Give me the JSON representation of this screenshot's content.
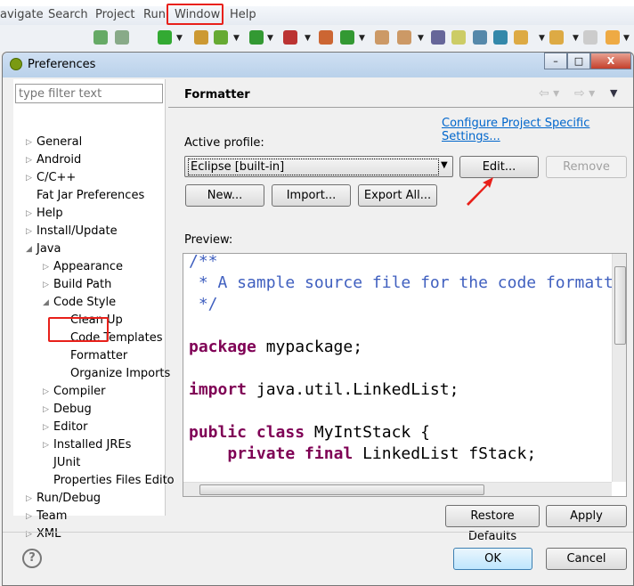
{
  "menubar": {
    "items": [
      "avigate",
      "Search",
      "Project",
      "Run",
      "Window",
      "Help"
    ]
  },
  "dialog": {
    "title": "Preferences",
    "window_buttons": [
      "minimize",
      "maximize",
      "close"
    ],
    "filter_placeholder": "type filter text",
    "tree": [
      {
        "label": "General",
        "level": 0,
        "arrow": "collapsed"
      },
      {
        "label": "Android",
        "level": 0,
        "arrow": "collapsed"
      },
      {
        "label": "C/C++",
        "level": 0,
        "arrow": "collapsed"
      },
      {
        "label": "Fat Jar Preferences",
        "level": 0,
        "arrow": "none"
      },
      {
        "label": "Help",
        "level": 0,
        "arrow": "collapsed"
      },
      {
        "label": "Install/Update",
        "level": 0,
        "arrow": "collapsed"
      },
      {
        "label": "Java",
        "level": 0,
        "arrow": "expanded"
      },
      {
        "label": "Appearance",
        "level": 1,
        "arrow": "collapsed"
      },
      {
        "label": "Build Path",
        "level": 1,
        "arrow": "collapsed"
      },
      {
        "label": "Code Style",
        "level": 1,
        "arrow": "expanded"
      },
      {
        "label": "Clean Up",
        "level": 2,
        "arrow": "none"
      },
      {
        "label": "Code Templates",
        "level": 2,
        "arrow": "none"
      },
      {
        "label": "Formatter",
        "level": 2,
        "arrow": "none",
        "selected": true
      },
      {
        "label": "Organize Imports",
        "level": 2,
        "arrow": "none"
      },
      {
        "label": "Compiler",
        "level": 1,
        "arrow": "collapsed"
      },
      {
        "label": "Debug",
        "level": 1,
        "arrow": "collapsed"
      },
      {
        "label": "Editor",
        "level": 1,
        "arrow": "collapsed"
      },
      {
        "label": "Installed JREs",
        "level": 1,
        "arrow": "collapsed"
      },
      {
        "label": "JUnit",
        "level": 1,
        "arrow": "none"
      },
      {
        "label": "Properties Files Edito",
        "level": 1,
        "arrow": "none"
      },
      {
        "label": "Run/Debug",
        "level": 0,
        "arrow": "collapsed"
      },
      {
        "label": "Team",
        "level": 0,
        "arrow": "collapsed"
      },
      {
        "label": "XML",
        "level": 0,
        "arrow": "collapsed"
      }
    ],
    "page_title": "Formatter",
    "configure_link": "Configure Project Specific Settings...",
    "active_profile_label": "Active profile:",
    "profile_value": "Eclipse [built-in]",
    "buttons": {
      "edit": "Edit...",
      "remove": "Remove",
      "new": "New...",
      "import": "Import...",
      "export": "Export All...",
      "restore": "Restore Defaults",
      "apply": "Apply",
      "ok": "OK",
      "cancel": "Cancel"
    },
    "preview_label": "Preview:",
    "preview_lines": [
      [
        {
          "t": "/**",
          "c": "cm"
        }
      ],
      [
        {
          "t": " * A sample source file for the code formatter preview",
          "c": "cm"
        }
      ],
      [
        {
          "t": " */",
          "c": "cm"
        }
      ],
      [],
      [
        {
          "t": "package",
          "c": "kw"
        },
        {
          "t": " mypackage;",
          "c": ""
        }
      ],
      [],
      [
        {
          "t": "import",
          "c": "kw"
        },
        {
          "t": " java.util.LinkedList;",
          "c": ""
        }
      ],
      [],
      [
        {
          "t": "public class",
          "c": "kw"
        },
        {
          "t": " MyIntStack {",
          "c": ""
        }
      ],
      [
        {
          "t": "    ",
          "c": ""
        },
        {
          "t": "private final",
          "c": "kw"
        },
        {
          "t": " LinkedList fStack;",
          "c": ""
        }
      ]
    ]
  },
  "colors": {
    "highlight": "#e8201a",
    "link": "#0066cc",
    "comment": "#3f5fbf",
    "keyword": "#7f0055"
  }
}
